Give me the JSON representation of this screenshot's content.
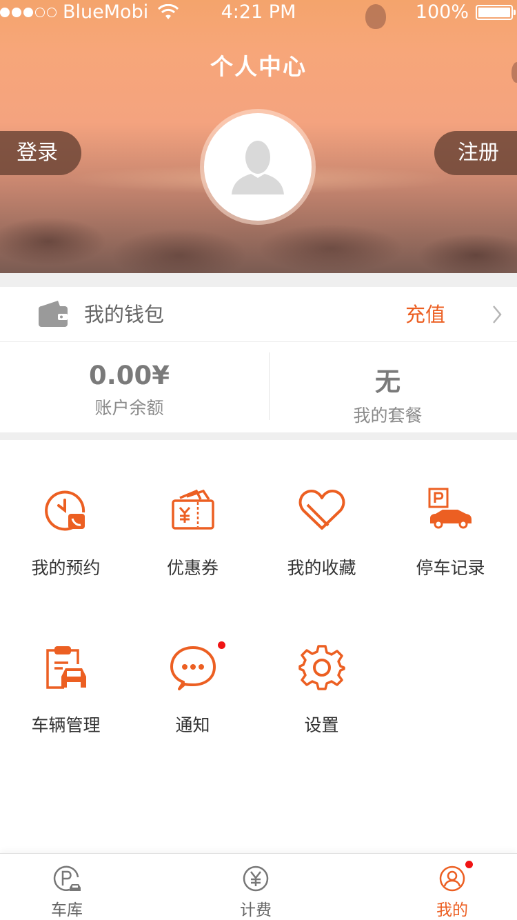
{
  "status_bar": {
    "carrier": "BlueMobi",
    "time": "4:21 PM",
    "battery": "100%",
    "signal_strength": 3
  },
  "header": {
    "title": "个人中心",
    "login_label": "登录",
    "register_label": "注册",
    "avatar_icon": "user-placeholder-icon"
  },
  "wallet": {
    "icon": "wallet-icon",
    "label": "我的钱包",
    "recharge_label": "充值",
    "balance_value": "0.00¥",
    "balance_caption": "账户余额",
    "package_value": "无",
    "package_caption": "我的套餐"
  },
  "menu": [
    {
      "label": "我的预约",
      "icon": "reservation-clock-icon"
    },
    {
      "label": "优惠券",
      "icon": "coupon-icon"
    },
    {
      "label": "我的收藏",
      "icon": "heart-icon"
    },
    {
      "label": "停车记录",
      "icon": "parking-car-icon"
    },
    {
      "label": "车辆管理",
      "icon": "vehicle-clipboard-icon"
    },
    {
      "label": "通知",
      "icon": "chat-notification-icon",
      "has_badge": true
    },
    {
      "label": "设置",
      "icon": "gear-icon"
    }
  ],
  "tab_bar": {
    "tabs": [
      {
        "label": "车库",
        "icon": "garage-parking-icon",
        "active": false
      },
      {
        "label": "计费",
        "icon": "yen-billing-icon",
        "active": false
      },
      {
        "label": "我的",
        "icon": "user-profile-icon",
        "active": true,
        "has_badge": true
      }
    ]
  },
  "colors": {
    "accent": "#ec5f22",
    "badge": "#f01414",
    "header_gradient_top": "#f4a46c",
    "header_gradient_bottom": "#7a5b52"
  }
}
